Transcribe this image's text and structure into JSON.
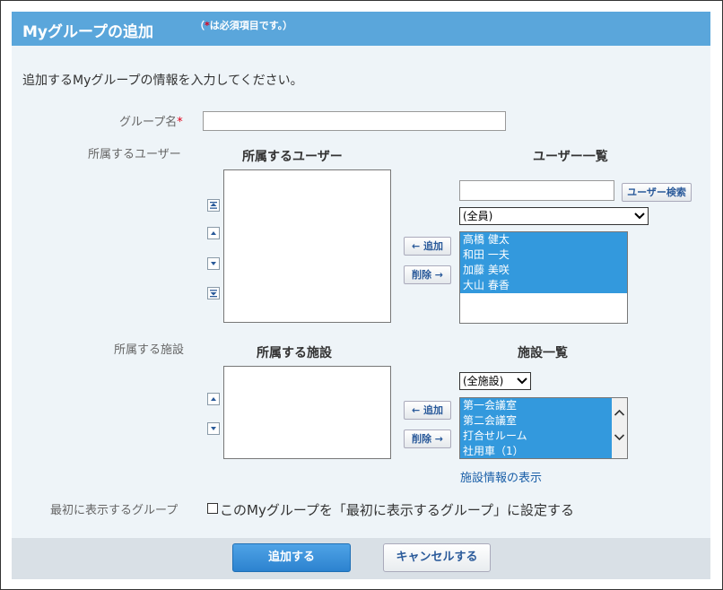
{
  "header": {
    "title": "Myグループの追加",
    "note_prefix": "（",
    "note_star": "*",
    "note_suffix": "は必須項目です。）"
  },
  "intro": "追加するMyグループの情報を入力してください。",
  "group_name": {
    "label": "グループ名",
    "required_mark": "*",
    "value": ""
  },
  "users": {
    "section_label": "所属するユーザー",
    "members_header": "所属するユーザー",
    "list_header": "ユーザー一覧",
    "search_value": "",
    "search_button": "ユーザー検索",
    "filter_selected": "(全員)",
    "add_button": "← 追加",
    "remove_button": "削除 →",
    "available": [
      "高橋 健太",
      "和田 一夫",
      "加藤 美咲",
      "大山 春香"
    ]
  },
  "facilities": {
    "section_label": "所属する施設",
    "members_header": "所属する施設",
    "list_header": "施設一覧",
    "filter_selected": "(全施設)",
    "add_button": "← 追加",
    "remove_button": "削除 →",
    "available": [
      "第一会議室",
      "第二会議室",
      "打合せルーム",
      "社用車（1）"
    ],
    "info_link": "施設情報の表示"
  },
  "default_group": {
    "label": "最初に表示するグループ",
    "checkbox_label": "このMyグループを「最初に表示するグループ」に設定する",
    "checked": false
  },
  "footer": {
    "submit": "追加する",
    "cancel": "キャンセルする"
  },
  "colors": {
    "header": "#5aa6db",
    "selection": "#3399dd",
    "panel": "#eef4f8",
    "link": "#1a5fa8"
  }
}
